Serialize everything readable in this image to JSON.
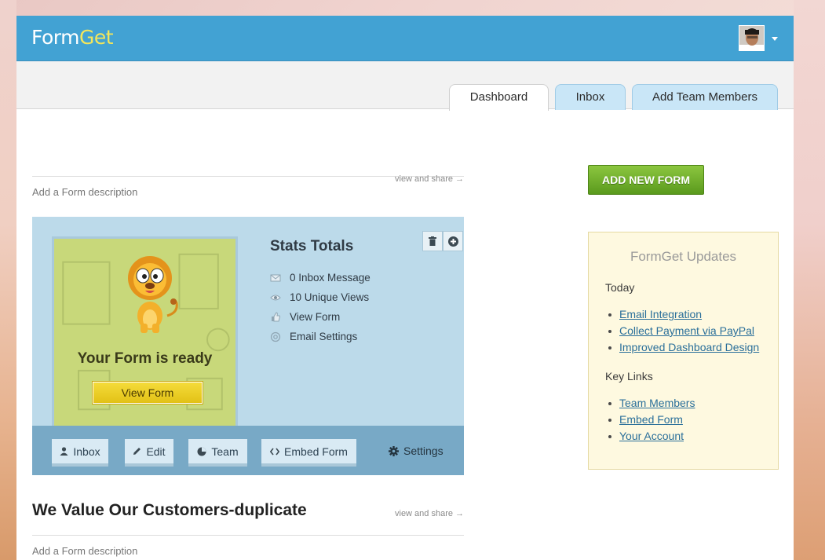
{
  "header": {
    "logo_form": "Form",
    "logo_get": "Get"
  },
  "tabs": [
    {
      "label": "Dashboard",
      "active": true
    },
    {
      "label": "Inbox",
      "active": false
    },
    {
      "label": "Add Team Members",
      "active": false
    }
  ],
  "forms": [
    {
      "title": "",
      "view_share": "view and share →",
      "description": "Add a Form description"
    },
    {
      "title": "We Value Our Customers-duplicate",
      "view_share": "view and share →",
      "description": "Add a Form description"
    }
  ],
  "card": {
    "preview_text": "Your Form is ready",
    "preview_button": "View Form",
    "stats_title": "Stats Totals",
    "stats": [
      {
        "icon": "envelope-icon",
        "label": "0 Inbox Message"
      },
      {
        "icon": "eye-icon",
        "label": "10 Unique Views"
      },
      {
        "icon": "thumb-icon",
        "label": "View Form"
      },
      {
        "icon": "at-icon",
        "label": "Email Settings"
      }
    ],
    "footer": {
      "inbox": "Inbox",
      "edit": "Edit",
      "team": "Team",
      "embed": "Embed Form",
      "settings": "Settings"
    }
  },
  "sidebar": {
    "add_button": "ADD NEW FORM",
    "updates_title": "FormGet Updates",
    "today_heading": "Today",
    "today_links": [
      "Email Integration",
      "Collect Payment via PayPal",
      "Improved Dashboard Design"
    ],
    "key_heading": "Key Links",
    "key_links": [
      "Team Members",
      "Embed Form",
      "Your Account"
    ]
  },
  "colors": {
    "header_blue": "#42a2d3",
    "logo_accent": "#f4e65a",
    "card_bg": "#bcdaea",
    "card_footer": "#78a9c6",
    "green_button": "#6fae2b",
    "updates_bg": "#fef9e0",
    "link": "#2a6f9a"
  }
}
